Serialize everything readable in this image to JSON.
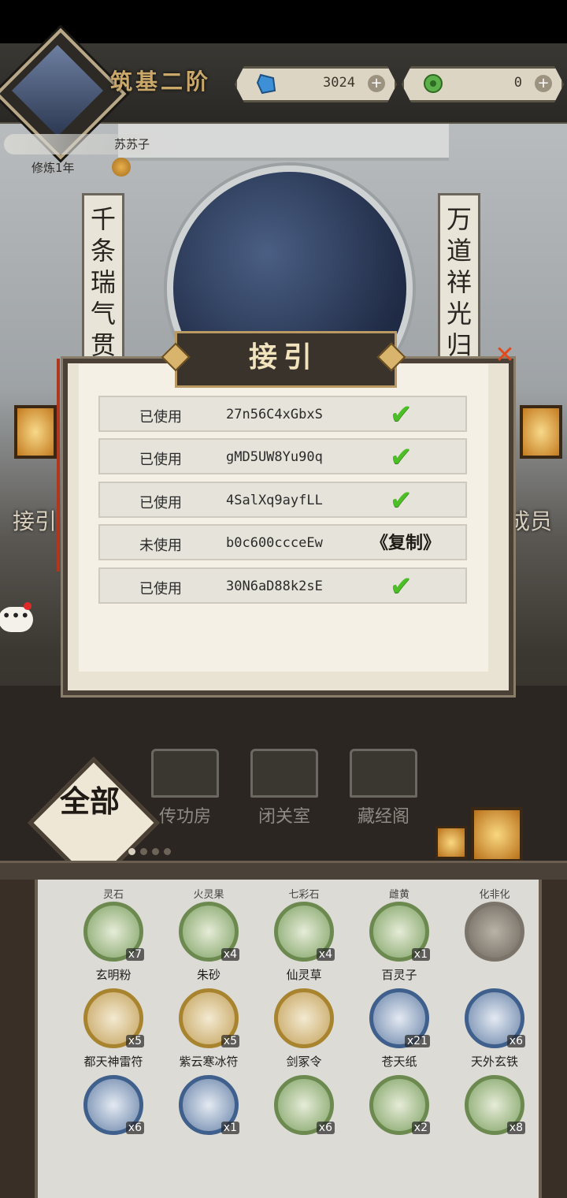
{
  "header": {
    "rank": "筑基二阶",
    "spirit_stones": "3024",
    "jade": "0",
    "plus": "+"
  },
  "player": {
    "name": "苏苏子",
    "cultivation_time": "修炼1年"
  },
  "scene": {
    "scroll_left": "千条瑞气贯",
    "scroll_right": "万道祥光归",
    "side_left": "接引",
    "side_right": "成员",
    "chat_dots": "•••"
  },
  "popup": {
    "title": "接引",
    "close": "✕",
    "rows": [
      {
        "status": "已使用",
        "code": "27n56C4xGbxS",
        "used": true
      },
      {
        "status": "已使用",
        "code": "gMD5UW8Yu90q",
        "used": true
      },
      {
        "status": "已使用",
        "code": "4SalXq9ayfLL",
        "used": true
      },
      {
        "status": "未使用",
        "code": "b0c600ccceEw",
        "used": false,
        "action": "《复制》"
      },
      {
        "status": "已使用",
        "code": "30N6aD88k2sE",
        "used": true
      }
    ],
    "check_glyph": "✔"
  },
  "nav": {
    "buildings": [
      "传功房",
      "闭关室",
      "藏经阁"
    ],
    "all_tab": "全部",
    "page_count": 4,
    "active_page": 0
  },
  "inventory": {
    "top_labels": [
      "灵石",
      "火灵果",
      "七彩石",
      "雌黄",
      "化非化"
    ],
    "rows": [
      [
        {
          "name": "玄明粉",
          "count": "x7",
          "ring": "green"
        },
        {
          "name": "朱砂",
          "count": "x4",
          "ring": "green"
        },
        {
          "name": "仙灵草",
          "count": "x4",
          "ring": "green"
        },
        {
          "name": "百灵子",
          "count": "x1",
          "ring": "green"
        },
        {
          "name": "",
          "count": "",
          "ring": "grey"
        }
      ],
      [
        {
          "name": "都天神雷符",
          "count": "x5",
          "ring": "gold"
        },
        {
          "name": "紫云寒冰符",
          "count": "x5",
          "ring": "gold"
        },
        {
          "name": "剑冢令",
          "count": "",
          "ring": "gold"
        },
        {
          "name": "苍天纸",
          "count": "x21",
          "ring": "blue"
        },
        {
          "name": "天外玄铁",
          "count": "x6",
          "ring": "blue"
        }
      ],
      [
        {
          "name": "",
          "count": "x6",
          "ring": "blue"
        },
        {
          "name": "",
          "count": "x1",
          "ring": "blue"
        },
        {
          "name": "",
          "count": "x6",
          "ring": "green"
        },
        {
          "name": "",
          "count": "x2",
          "ring": "green"
        },
        {
          "name": "",
          "count": "x8",
          "ring": "green"
        }
      ]
    ]
  },
  "colors": {
    "check_green": "#4bbf25",
    "close_red": "#e14a1c",
    "title_gold": "#c9a86a"
  }
}
